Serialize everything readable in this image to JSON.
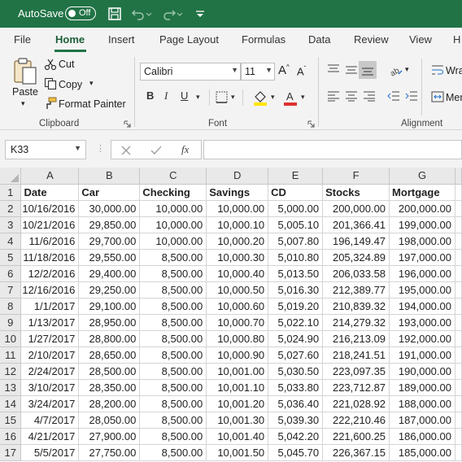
{
  "titlebar": {
    "autosave_label": "AutoSave",
    "autosave_state": "Off",
    "icons": [
      "save-icon",
      "undo-icon",
      "redo-icon",
      "customize-qat-icon"
    ]
  },
  "ribbon_tabs": [
    "File",
    "Home",
    "Insert",
    "Page Layout",
    "Formulas",
    "Data",
    "Review",
    "View",
    "H"
  ],
  "active_tab": "Home",
  "clipboard": {
    "paste": "Paste",
    "cut": "Cut",
    "copy": "Copy",
    "format_painter": "Format Painter",
    "group_label": "Clipboard"
  },
  "font": {
    "name": "Calibri",
    "size": "11",
    "bold": "B",
    "italic": "I",
    "underline": "U",
    "group_label": "Font"
  },
  "alignment": {
    "wrap": "Wra",
    "merge": "Mer",
    "group_label": "Alignment"
  },
  "formula_bar": {
    "name_box": "K33",
    "fx": "fx",
    "formula": ""
  },
  "sheet": {
    "columns": [
      "A",
      "B",
      "C",
      "D",
      "E",
      "F",
      "G"
    ],
    "headers": [
      "Date",
      "Car",
      "Checking",
      "Savings",
      "CD",
      "Stocks",
      "Mortgage"
    ],
    "rows": [
      [
        "10/16/2016",
        "30,000.00",
        "10,000.00",
        "10,000.00",
        "5,000.00",
        "200,000.00",
        "200,000.00"
      ],
      [
        "10/21/2016",
        "29,850.00",
        "10,000.00",
        "10,000.10",
        "5,005.10",
        "201,366.41",
        "199,000.00"
      ],
      [
        "11/6/2016",
        "29,700.00",
        "10,000.00",
        "10,000.20",
        "5,007.80",
        "196,149.47",
        "198,000.00"
      ],
      [
        "11/18/2016",
        "29,550.00",
        "8,500.00",
        "10,000.30",
        "5,010.80",
        "205,324.89",
        "197,000.00"
      ],
      [
        "12/2/2016",
        "29,400.00",
        "8,500.00",
        "10,000.40",
        "5,013.50",
        "206,033.58",
        "196,000.00"
      ],
      [
        "12/16/2016",
        "29,250.00",
        "8,500.00",
        "10,000.50",
        "5,016.30",
        "212,389.77",
        "195,000.00"
      ],
      [
        "1/1/2017",
        "29,100.00",
        "8,500.00",
        "10,000.60",
        "5,019.20",
        "210,839.32",
        "194,000.00"
      ],
      [
        "1/13/2017",
        "28,950.00",
        "8,500.00",
        "10,000.70",
        "5,022.10",
        "214,279.32",
        "193,000.00"
      ],
      [
        "1/27/2017",
        "28,800.00",
        "8,500.00",
        "10,000.80",
        "5,024.90",
        "216,213.09",
        "192,000.00"
      ],
      [
        "2/10/2017",
        "28,650.00",
        "8,500.00",
        "10,000.90",
        "5,027.60",
        "218,241.51",
        "191,000.00"
      ],
      [
        "2/24/2017",
        "28,500.00",
        "8,500.00",
        "10,001.00",
        "5,030.50",
        "223,097.35",
        "190,000.00"
      ],
      [
        "3/10/2017",
        "28,350.00",
        "8,500.00",
        "10,001.10",
        "5,033.80",
        "223,712.87",
        "189,000.00"
      ],
      [
        "3/24/2017",
        "28,200.00",
        "8,500.00",
        "10,001.20",
        "5,036.40",
        "221,028.92",
        "188,000.00"
      ],
      [
        "4/7/2017",
        "28,050.00",
        "8,500.00",
        "10,001.30",
        "5,039.30",
        "222,210.46",
        "187,000.00"
      ],
      [
        "4/21/2017",
        "27,900.00",
        "8,500.00",
        "10,001.40",
        "5,042.20",
        "221,600.25",
        "186,000.00"
      ],
      [
        "5/5/2017",
        "27,750.00",
        "8,500.00",
        "10,001.50",
        "5,045.70",
        "226,367.15",
        "185,000.00"
      ]
    ]
  },
  "colors": {
    "brand": "#217346",
    "ribbon_bg": "#f3f3f3",
    "header_bg": "#e9e9e9",
    "font_color_red": "#e03030",
    "highlight_yellow": "#ffe600"
  }
}
